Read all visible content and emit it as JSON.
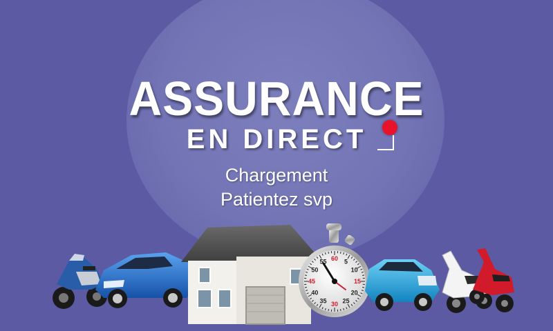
{
  "brand": {
    "line1": "ASSURANCE",
    "line2": "EN DIRECT"
  },
  "loading": {
    "line1": "Chargement",
    "line2": "Patientez svp"
  },
  "stopwatch": {
    "marks": [
      "60",
      "5",
      "10",
      "15",
      "20",
      "25",
      "30",
      "35",
      "40",
      "45",
      "50",
      "55"
    ]
  },
  "colors": {
    "background": "#5b5aa3",
    "halo": "#7c7ebd",
    "rec_dot": "#e8122a",
    "car_blue": "#1e6fd0",
    "car_cyan": "#1fa6e0",
    "scooter_red": "#d11b2a"
  },
  "icons": [
    "motorcycle-icon",
    "car-icon",
    "house-icon",
    "stopwatch-icon",
    "car-icon",
    "scooter-icon",
    "scooter-icon"
  ]
}
